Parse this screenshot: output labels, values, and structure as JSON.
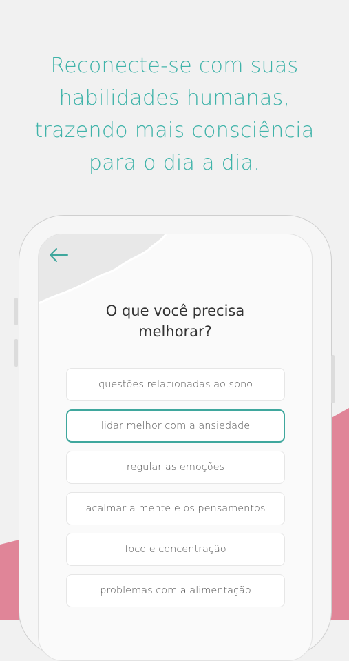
{
  "headline": {
    "lines": [
      "Reconecte-se com suas",
      "habilidades humanas,",
      "trazendo mais consciência",
      "para o dia a dia."
    ]
  },
  "screen": {
    "question_line1": "O que você precisa",
    "question_line2": "melhorar?",
    "back_icon": "arrow-left-icon",
    "options": [
      {
        "label": "questões relacionadas ao sono",
        "selected": false
      },
      {
        "label": "lidar melhor com a ansiedade",
        "selected": true
      },
      {
        "label": "regular as emoções",
        "selected": false
      },
      {
        "label": "acalmar a mente e os pensamentos",
        "selected": false
      },
      {
        "label": "foco e concentração",
        "selected": false
      },
      {
        "label": "problemas com a alimentação",
        "selected": false
      }
    ]
  },
  "colors": {
    "accent": "#3fb3a9",
    "pink": "#e08598",
    "background": "#f1f1f1"
  }
}
